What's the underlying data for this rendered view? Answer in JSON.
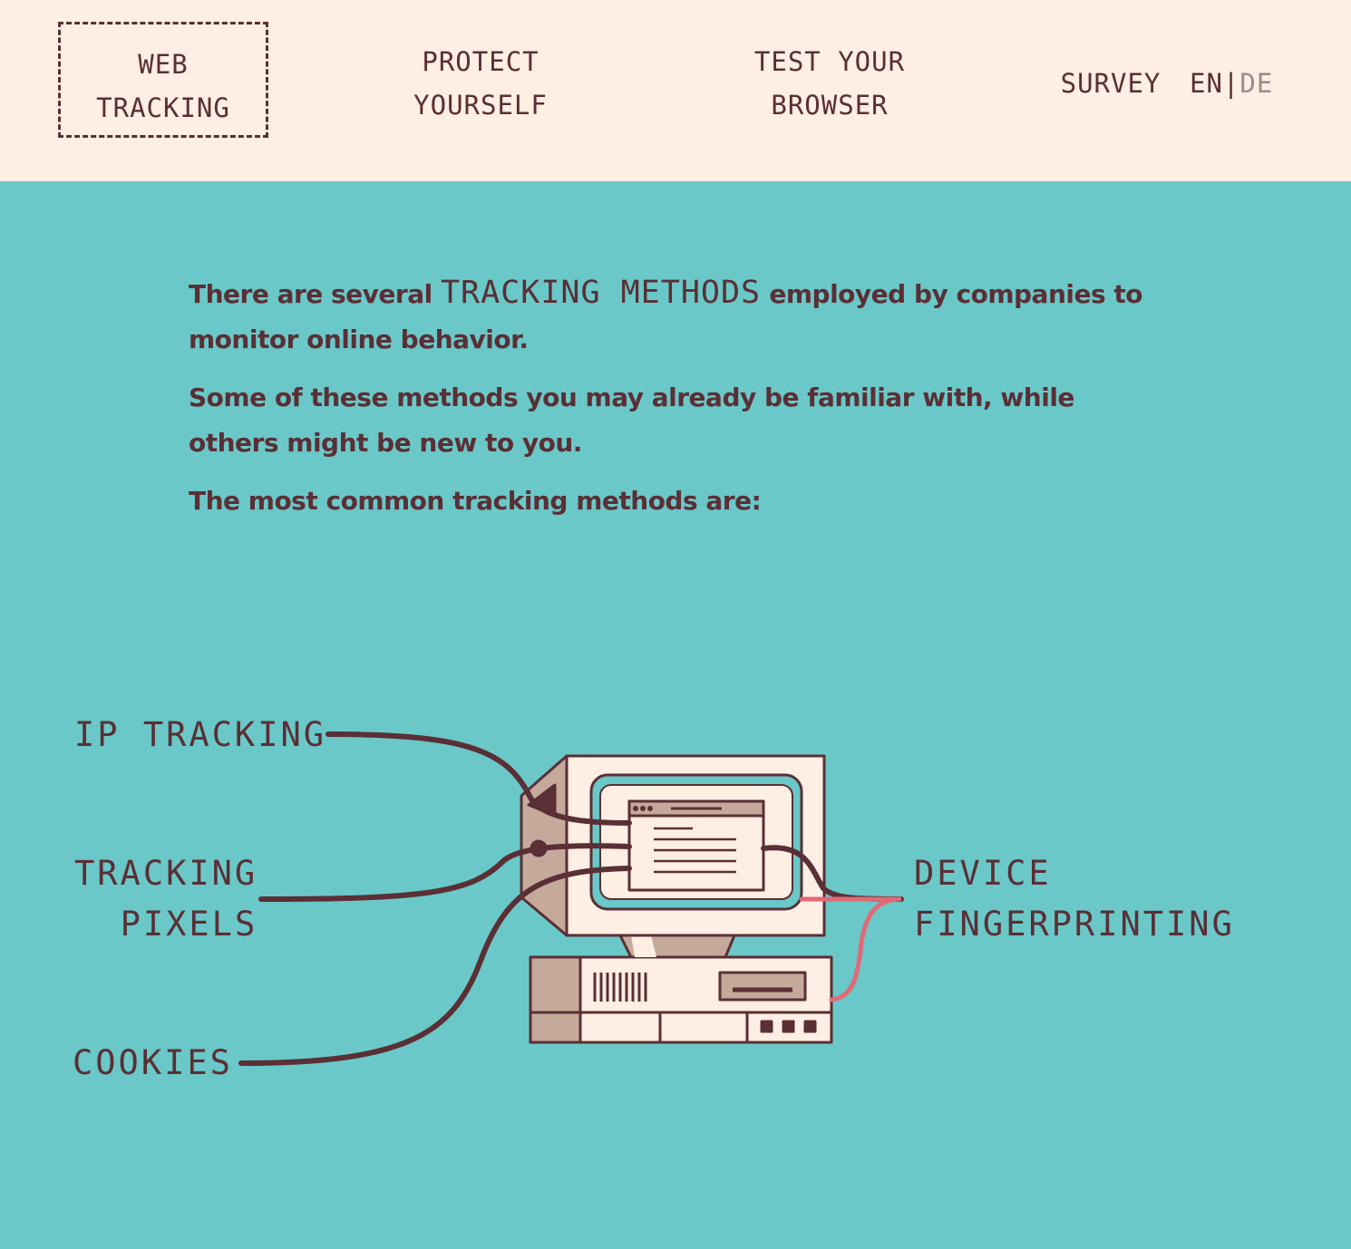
{
  "nav": {
    "web_tracking": [
      "WEB",
      "TRACKING"
    ],
    "protect_yourself": [
      "PROTECT",
      "YOURSELF"
    ],
    "test_browser": [
      "TEST YOUR",
      "BROWSER"
    ],
    "survey": "SURVEY"
  },
  "language": {
    "active": "EN",
    "separator": "|",
    "inactive": "DE"
  },
  "intro": {
    "p1_before": "There are several ",
    "p1_highlight": "TRACKING METHODS",
    "p1_after": " employed by companies to monitor online behavior.",
    "p2": "Some of these methods you may already be familiar with, while others might be new to you.",
    "p3": "The most common tracking methods are:"
  },
  "methods": {
    "ip": "IP TRACKING",
    "pixels": [
      "TRACKING",
      "PIXELS"
    ],
    "cookies": "COOKIES",
    "device": [
      "DEVICE",
      "FINGERPRINTING"
    ]
  },
  "colors": {
    "background": "#6bc8c8",
    "header": "#ffeee3",
    "text": "#5a2f35",
    "accent_line": "#e06a78",
    "inactive_lang": "#9b8a8c"
  }
}
